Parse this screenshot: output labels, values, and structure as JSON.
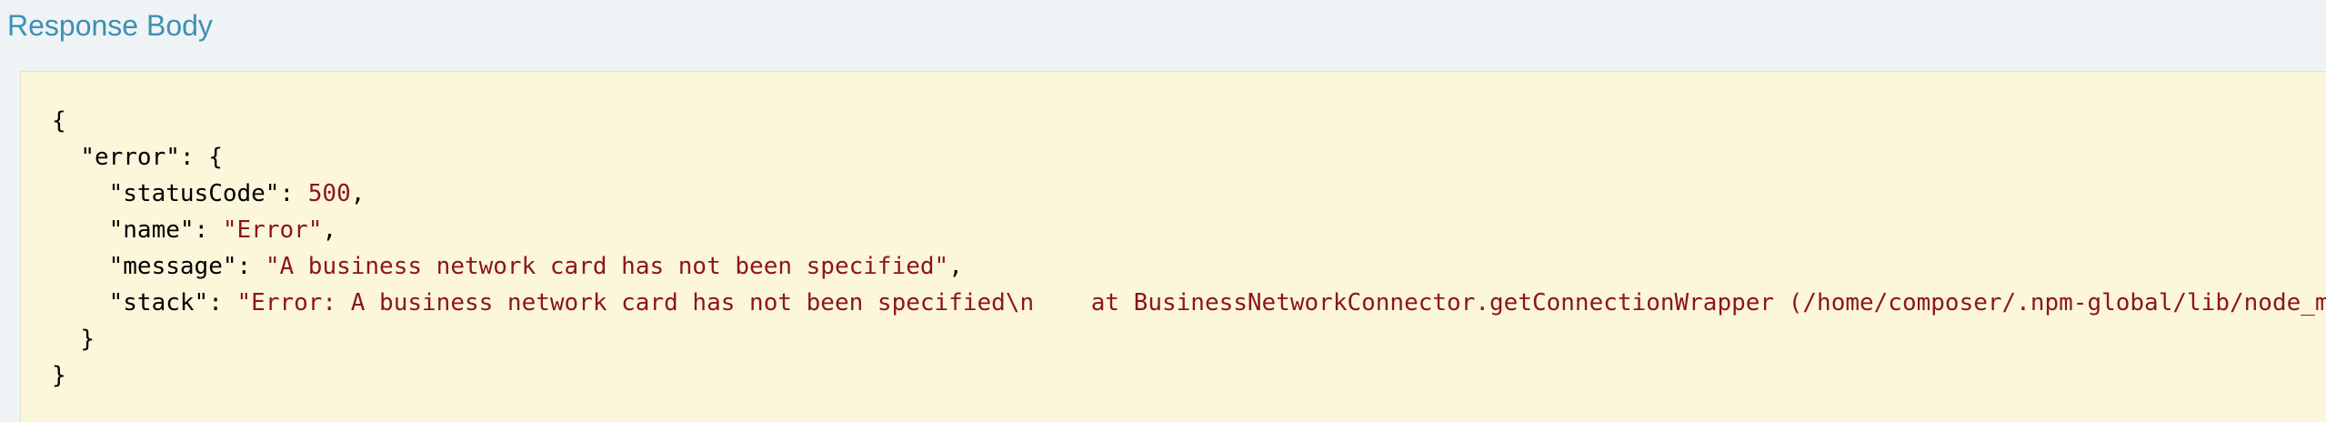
{
  "section": {
    "title": "Response Body"
  },
  "response": {
    "open_brace": "{",
    "close_brace": "}",
    "error_key": "\"error\"",
    "error_open": ": {",
    "error_close": "}",
    "fields": [
      {
        "key": "\"statusCode\"",
        "value": "500",
        "suffix": ","
      },
      {
        "key": "\"name\"",
        "value": "\"Error\"",
        "suffix": ","
      },
      {
        "key": "\"message\"",
        "value": "\"A business network card has not been specified\"",
        "suffix": ","
      },
      {
        "key": "\"stack\"",
        "value": "\"Error: A business network card has not been specified\\n    at BusinessNetworkConnector.getConnectionWrapper (/home/composer/.npm-global/lib/node_m",
        "suffix": ""
      }
    ]
  },
  "colors": {
    "title": "#3f90b3",
    "panel_bg": "#fcf6db",
    "string_value": "#8c1616",
    "page_bg": "#eef3f6"
  }
}
